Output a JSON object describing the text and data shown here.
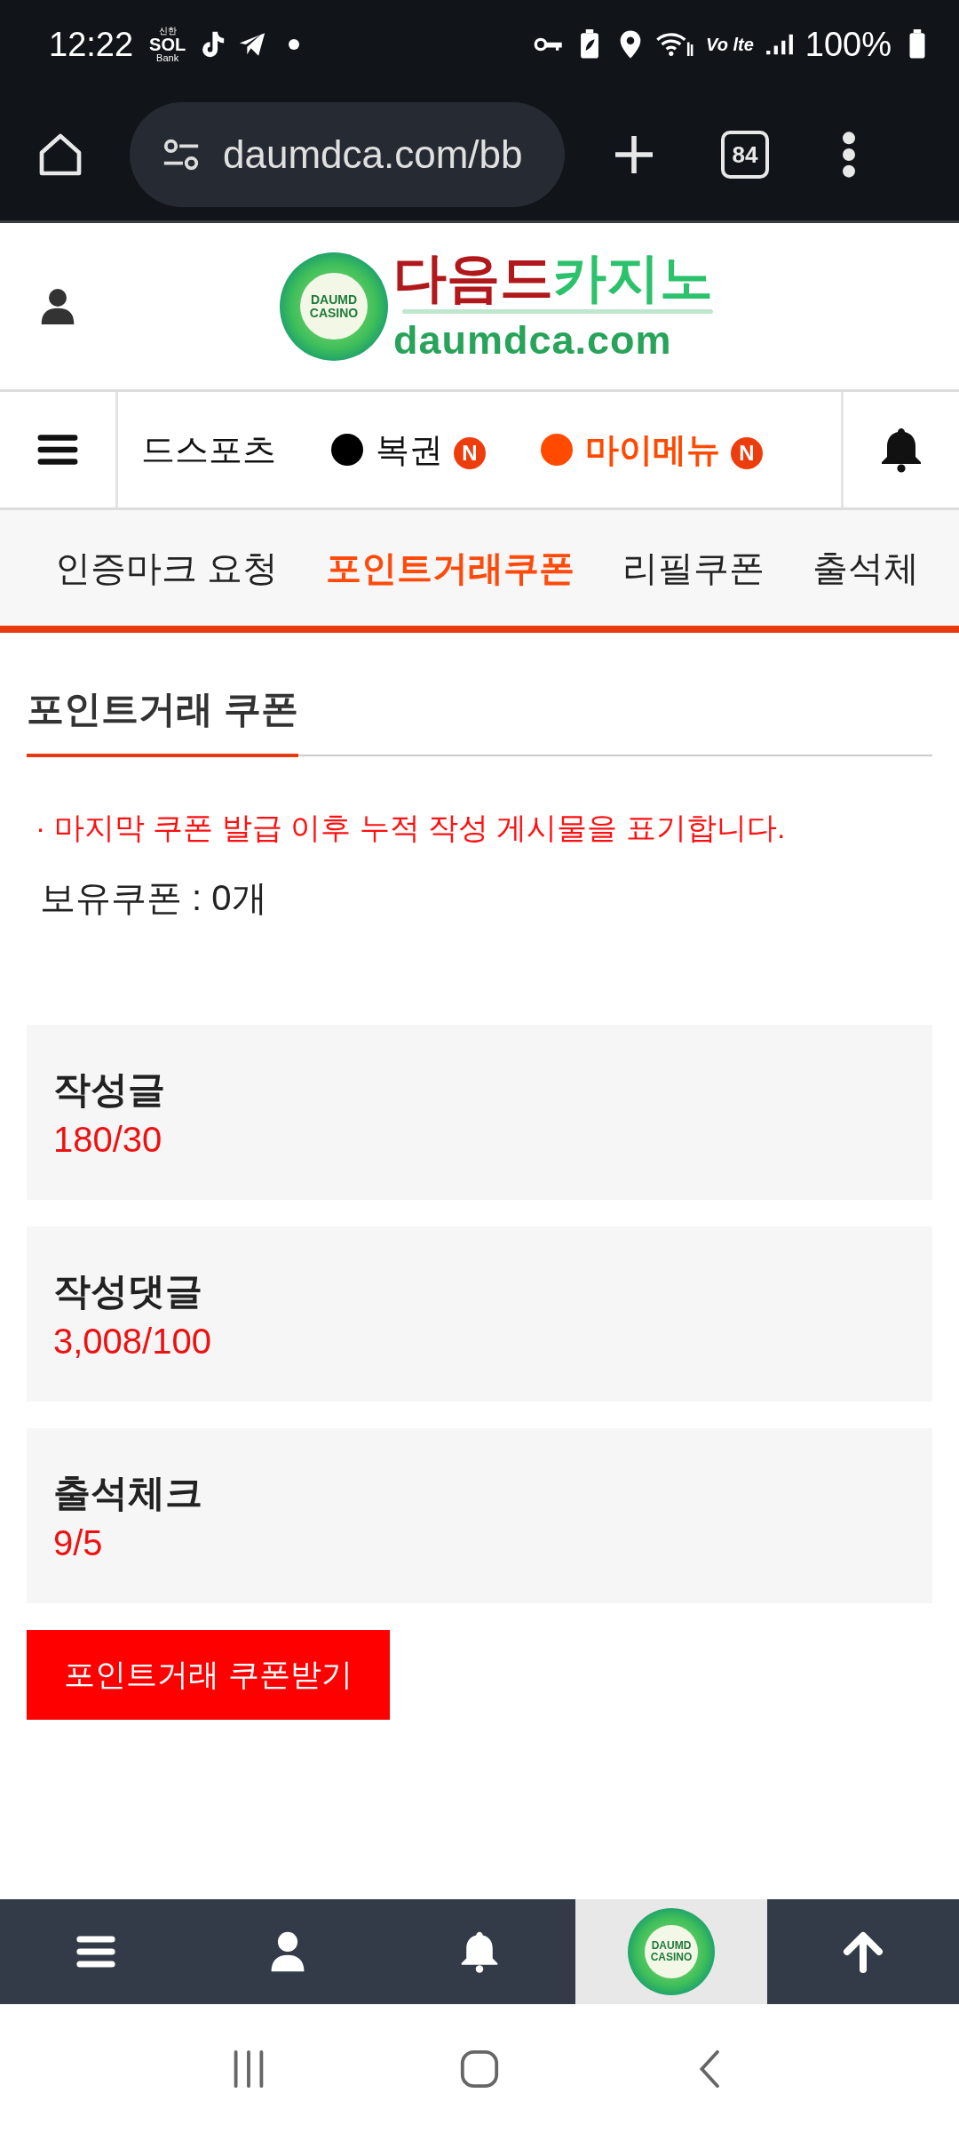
{
  "status_bar": {
    "time": "12:22",
    "bank_app": {
      "top": "신한",
      "main": "SOL",
      "bottom": "Bank"
    },
    "network": "Vo lte",
    "battery": "100%"
  },
  "browser": {
    "url": "daumdca.com/bb",
    "tab_count": "84"
  },
  "header": {
    "brand_red": "다음드",
    "brand_green": "카지노",
    "domain": "daumdca.com",
    "badge_lines": [
      "DAUMD",
      "CASINO"
    ]
  },
  "main_nav": [
    {
      "label": "드스포츠",
      "selected": false
    },
    {
      "label": "복권",
      "color": "#000000",
      "badge": "N",
      "selected": false
    },
    {
      "label": "마이메뉴",
      "color": "#ff4a00",
      "badge": "N",
      "selected": true
    }
  ],
  "sub_nav": [
    {
      "label": "인증마크 요청",
      "selected": false
    },
    {
      "label": "포인트거래쿠폰",
      "selected": true
    },
    {
      "label": "리필쿠폰",
      "selected": false
    },
    {
      "label": "출석체",
      "selected": false
    }
  ],
  "section_title": "포인트거래 쿠폰",
  "notice": "· 마지막 쿠폰 발급 이후 누적 작성 게시물을 표기합니다.",
  "coupon_count": "보유쿠폰 : 0개",
  "stats": [
    {
      "label": "작성글",
      "value": "180/30"
    },
    {
      "label": "작성댓글",
      "value": "3,008/100"
    },
    {
      "label": "출석체크",
      "value": "9/5"
    }
  ],
  "claim_button": "포인트거래 쿠폰받기",
  "bottom_nav": [
    {
      "kind": "menu",
      "selected": false
    },
    {
      "kind": "user",
      "selected": false
    },
    {
      "kind": "bell",
      "selected": false
    },
    {
      "kind": "logo",
      "selected": true,
      "lines": [
        "DAUMD",
        "CASINO"
      ]
    },
    {
      "kind": "top",
      "selected": false
    }
  ]
}
